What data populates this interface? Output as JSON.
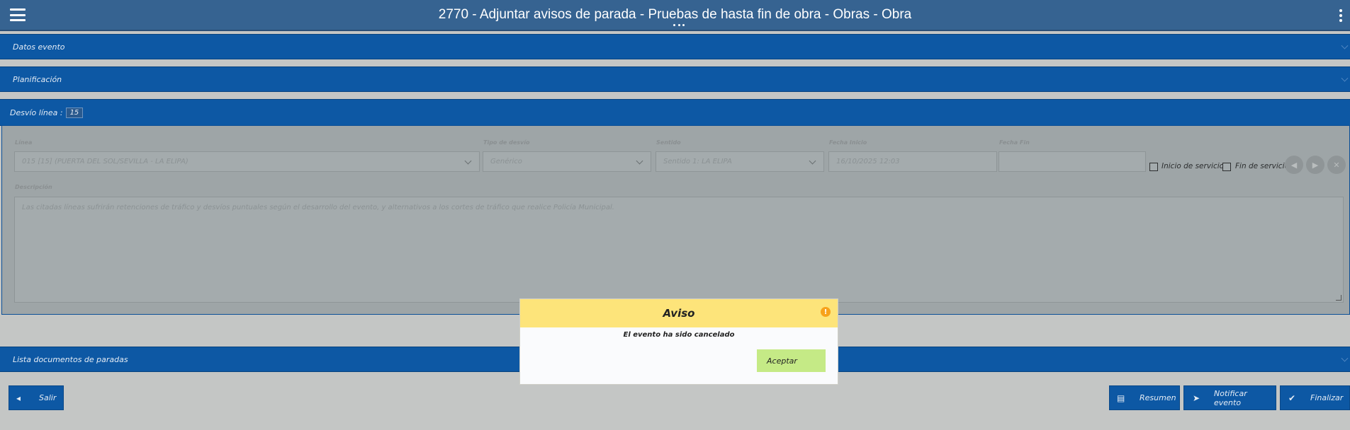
{
  "header": {
    "title": "2770 - Adjuntar avisos de parada - Pruebas de hasta fin de obra - Obras - Obra",
    "menu_icon": "hamburger-icon",
    "more_icon": "kebab-icon"
  },
  "sections": {
    "datos_evento": "Datos evento",
    "planificacion": "Planificación",
    "lista_documentos": "Lista documentos de paradas"
  },
  "desvio": {
    "label": "Desvío línea :",
    "number": "15",
    "fields": {
      "linea": {
        "label": "Línea",
        "value": "015 [15] (PUERTA DEL SOL/SEVILLA - LA ELIPA)"
      },
      "tipo_desvio": {
        "label": "Tipo de desvío",
        "value": "Genérico"
      },
      "sentido": {
        "label": "Sentido",
        "value": "Sentido 1: LA ELIPA"
      },
      "fecha_inicio": {
        "label": "Fecha Inicio",
        "value": "16/10/2025 12:03"
      },
      "fecha_fin": {
        "label": "Fecha Fin",
        "value": ""
      }
    },
    "checkboxes": {
      "inicio_servicio": {
        "label": "Inicio de servicio",
        "checked": false
      },
      "fin_servicio": {
        "label": "Fin de servicio",
        "checked": false
      }
    },
    "descripcion": {
      "label": "Descripción",
      "value": "Las citadas líneas sufrirán retenciones de tráfico y desvíos puntuales según el desarrollo del evento, y alternativos a los cortes de tráfico que realice Policía Municipal."
    }
  },
  "footer": {
    "salir": "Salir",
    "resumen": "Resumen",
    "notificar": "Notificar evento",
    "finalizar": "Finalizar"
  },
  "modal": {
    "title": "Aviso",
    "message": "El evento ha sido cancelado",
    "accept": "Aceptar",
    "icon": "warning-icon"
  },
  "colors": {
    "header": "#366391",
    "section_bar": "#0d58a4",
    "overlay": "#c4c6c5",
    "modal_header": "#fde47a",
    "accept_button": "#c5ea86"
  }
}
